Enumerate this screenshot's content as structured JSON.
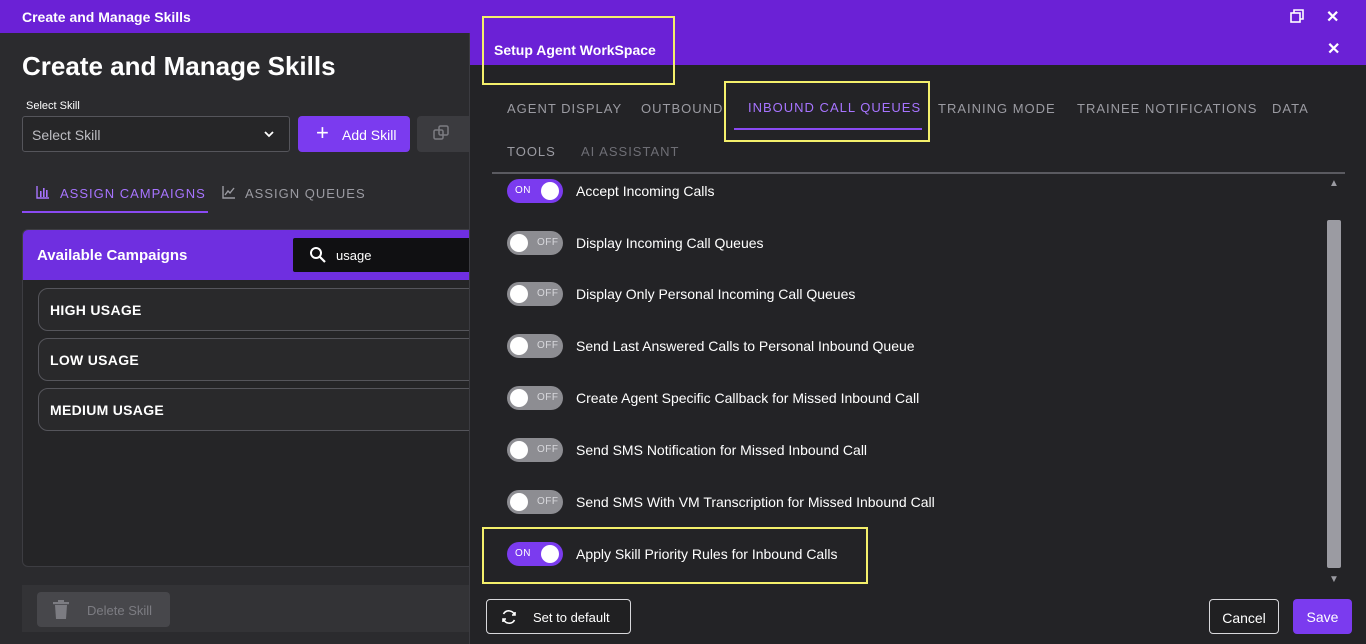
{
  "window": {
    "title": "Create and Manage Skills"
  },
  "left": {
    "page_title": "Create and Manage Skills",
    "select_skill_label": "Select Skill",
    "select_skill_placeholder": "Select Skill",
    "add_skill_label": "Add Skill",
    "tabs": [
      {
        "label": "ASSIGN CAMPAIGNS",
        "icon": "bar-chart-icon",
        "active": true
      },
      {
        "label": "ASSIGN QUEUES",
        "icon": "line-chart-icon",
        "active": false
      }
    ],
    "campaigns_title": "Available Campaigns",
    "search_value": "usage",
    "campaigns": [
      "HIGH USAGE",
      "LOW USAGE",
      "MEDIUM USAGE"
    ],
    "delete_label": "Delete Skill"
  },
  "modal": {
    "title": "Setup Agent WorkSpace",
    "tabs": [
      "AGENT DISPLAY",
      "OUTBOUND",
      "INBOUND CALL QUEUES",
      "TRAINING MODE",
      "TRAINEE NOTIFICATIONS",
      "DATA",
      "TOOLS",
      "AI ASSISTANT"
    ],
    "active_tab": "INBOUND CALL QUEUES",
    "settings": [
      {
        "label": "Accept Incoming Calls",
        "state": "ON"
      },
      {
        "label": "Display Incoming Call Queues",
        "state": "OFF"
      },
      {
        "label": "Display Only Personal Incoming Call Queues",
        "state": "OFF"
      },
      {
        "label": "Send Last Answered Calls to Personal Inbound Queue",
        "state": "OFF"
      },
      {
        "label": "Create Agent Specific Callback for Missed Inbound Call",
        "state": "OFF"
      },
      {
        "label": "Send SMS Notification for Missed Inbound Call",
        "state": "OFF"
      },
      {
        "label": "Send SMS With VM Transcription for Missed Inbound Call",
        "state": "OFF"
      },
      {
        "label": "Apply Skill Priority Rules for Inbound Calls",
        "state": "ON"
      }
    ],
    "set_default_label": "Set to default",
    "cancel_label": "Cancel",
    "save_label": "Save"
  },
  "colors": {
    "accent": "#6b21d6",
    "button_primary": "#7b3bef",
    "highlight": "#f4ef6b"
  }
}
